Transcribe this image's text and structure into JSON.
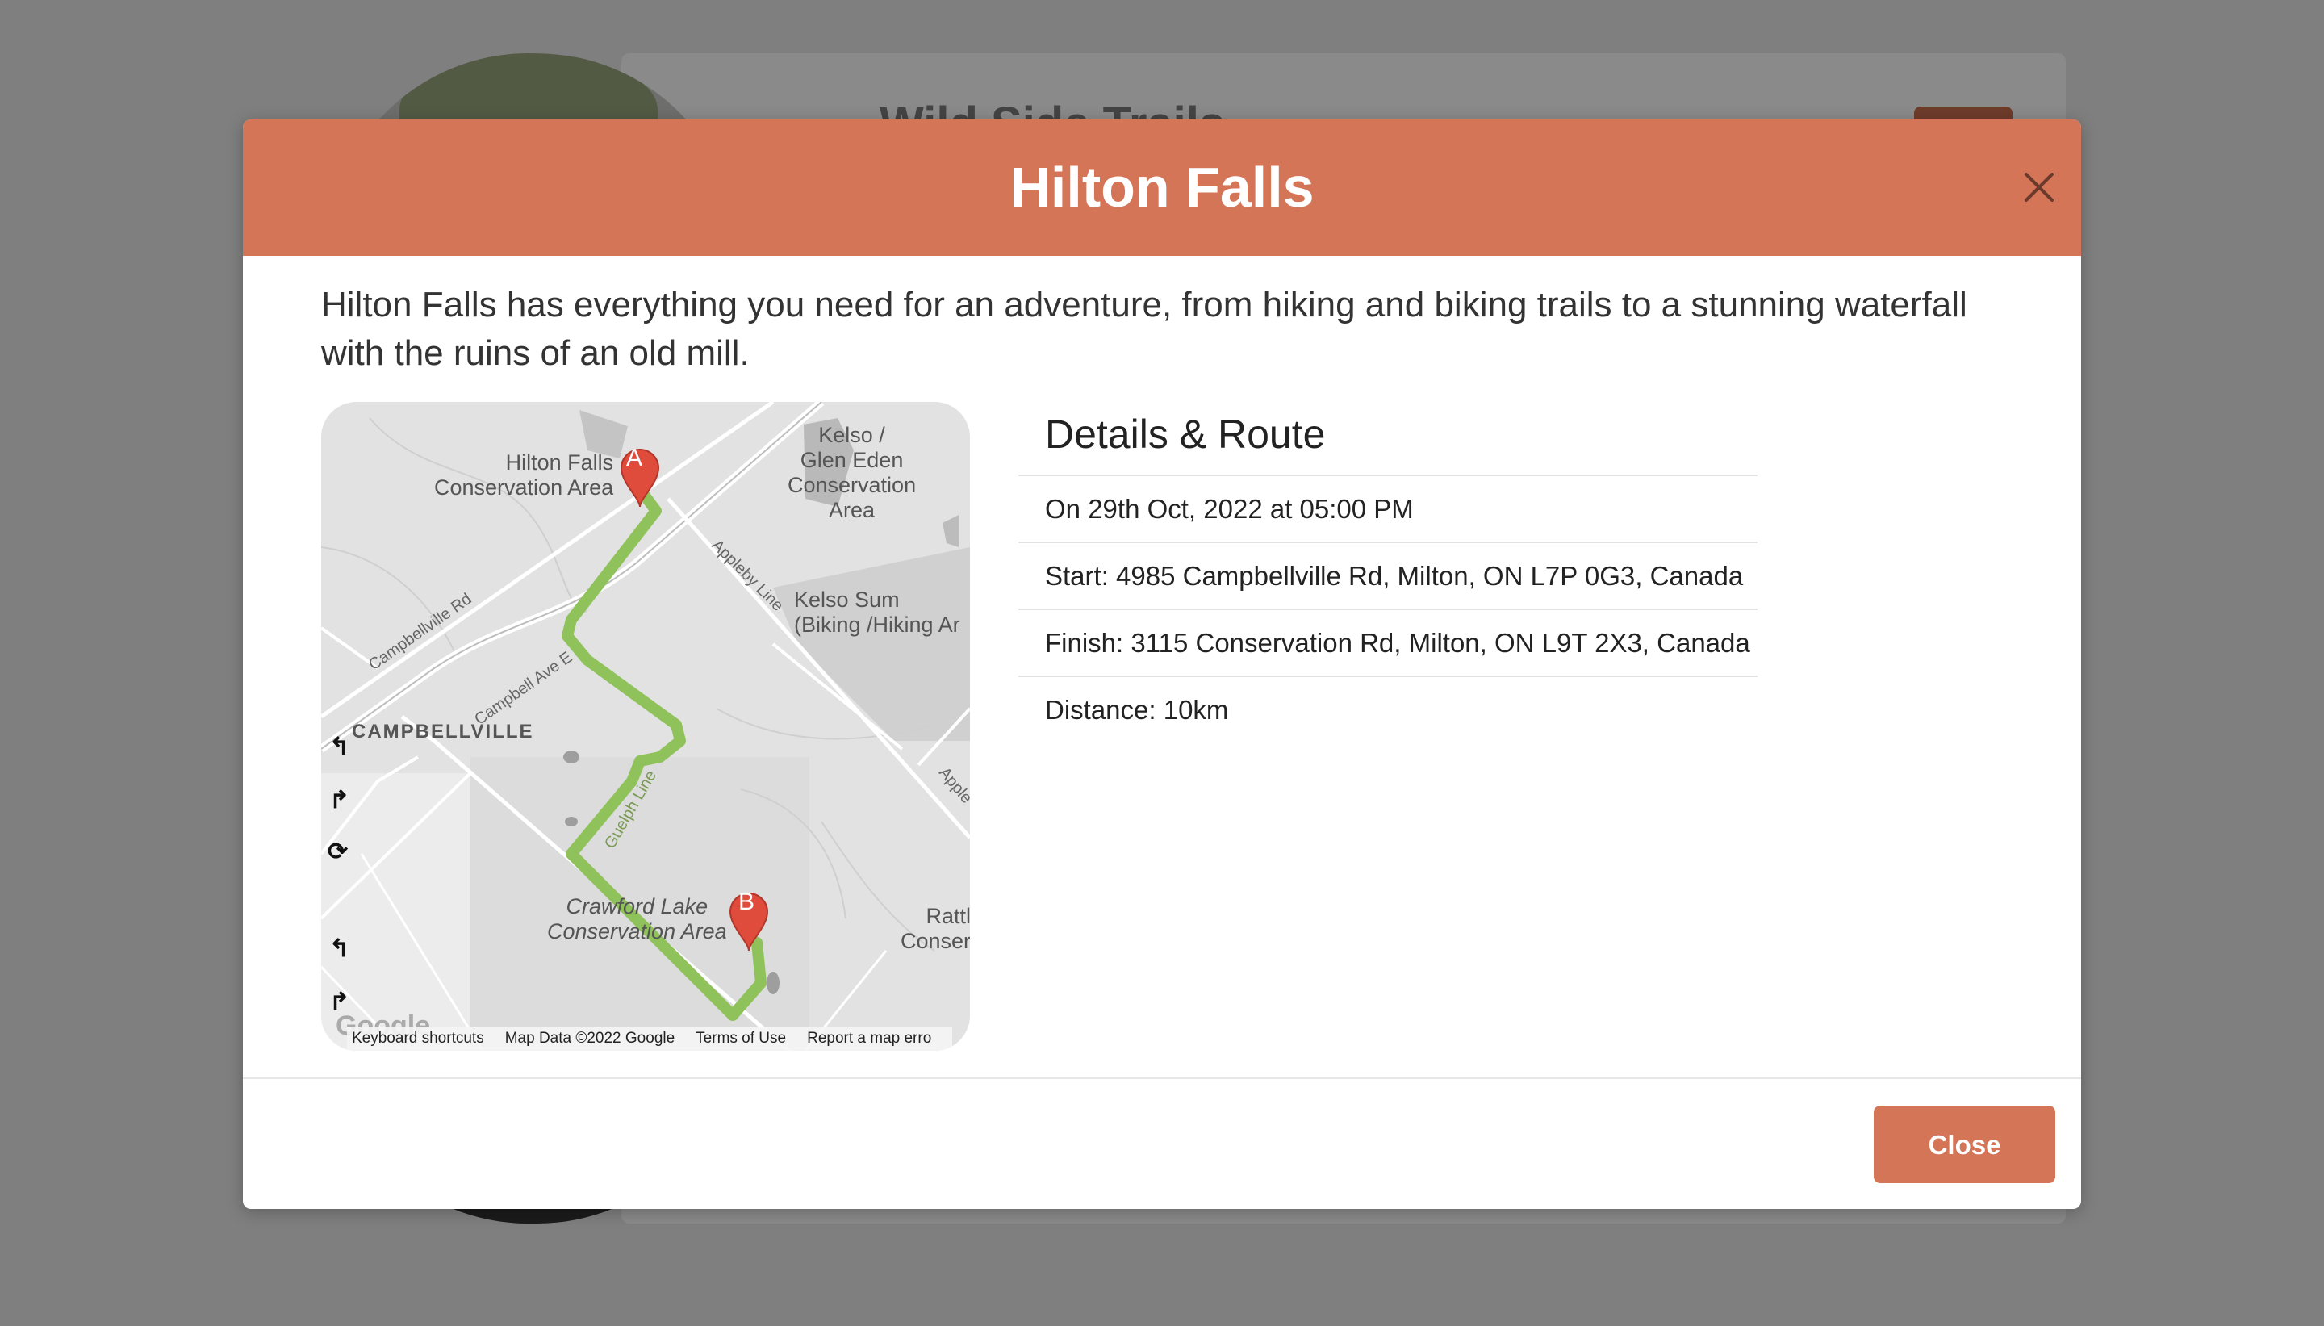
{
  "background": {
    "card_title": "Wild Side Trails"
  },
  "modal": {
    "title": "Hilton Falls",
    "close_icon": "close-icon",
    "description": "Hilton Falls has everything you need for an adventure, from hiking and biking trails to a stunning waterfall with the ruins of an old mill.",
    "map": {
      "marker_a": "A",
      "marker_b": "B",
      "labels": {
        "hilton": "Hilton Falls\nConservation Area",
        "kelso": "Kelso /\nGlen Eden\nConservation\nArea",
        "kelso_summit": "Kelso Sum\n(Biking /Hiking Ar",
        "campbellville": "CAMPBELLVILLE",
        "crawford": "Crawford Lake\nConservation Area",
        "rattl": "Rattl\nConser",
        "appleby": "Appleby Line",
        "appleby2": "Apple",
        "campbellville_rd": "Campbellville Rd",
        "campbell_ave": "Campbell Ave E",
        "guelph_line": "Guelph Line",
        "google": "Google"
      },
      "footer": {
        "shortcuts": "Keyboard shortcuts",
        "map_data": "Map Data ©2022 Google",
        "terms": "Terms of Use",
        "report": "Report a map erro"
      }
    },
    "details": {
      "title": "Details & Route",
      "date": "On 29th Oct, 2022 at 05:00 PM",
      "start": "Start: 4985 Campbellville Rd, Milton, ON L7P 0G3, Canada",
      "finish": "Finish: 3115 Conservation Rd, Milton, ON L9T 2X3, Canada",
      "distance": "Distance: 10km"
    },
    "close_button": "Close",
    "accent_color": "#d57557",
    "route_color": "#8fc25a"
  }
}
